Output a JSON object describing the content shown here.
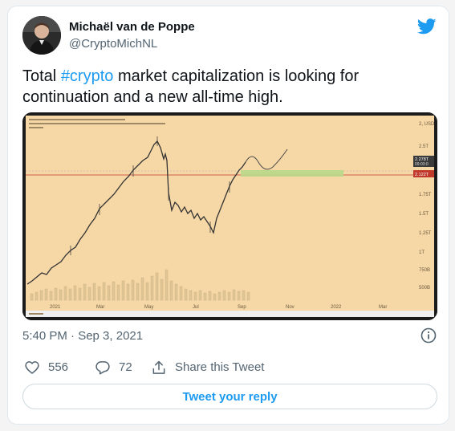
{
  "author": {
    "name": "Michaël van de Poppe",
    "handle": "@CryptoMichNL"
  },
  "tweet": {
    "text_before": "Total ",
    "hashtag": "#crypto",
    "text_after": " market capitalization is looking for continuation and a new all-time high.",
    "timestamp": "5:40 PM · Sep 3, 2021"
  },
  "media": {
    "chart_price_labels": [
      "2, USD",
      "2.5T",
      "2.278T",
      "09:03:0",
      "2.122T",
      "1.75T",
      "1.5T",
      "1.25T",
      "1T",
      "750B",
      "500B"
    ],
    "chart_time_labels": [
      "2021",
      "Mar",
      "May",
      "Jul",
      "Sep",
      "Nov",
      "2022",
      "Mar"
    ]
  },
  "actions": {
    "like_count": "556",
    "reply_count": "72",
    "share_label": "Share this Tweet"
  },
  "reply_button_label": "Tweet your reply",
  "colors": {
    "accent": "#1d9bf0",
    "chart_background": "#f6d7a6",
    "price_tag_current": "#3a3a3a",
    "price_tag_level": "#c0392b",
    "target_zone": "#b8d98a"
  },
  "icons": {
    "brand": "twitter-bird-icon",
    "info": "info-icon",
    "like": "heart-icon",
    "reply": "reply-bubble-icon",
    "share": "share-icon"
  }
}
